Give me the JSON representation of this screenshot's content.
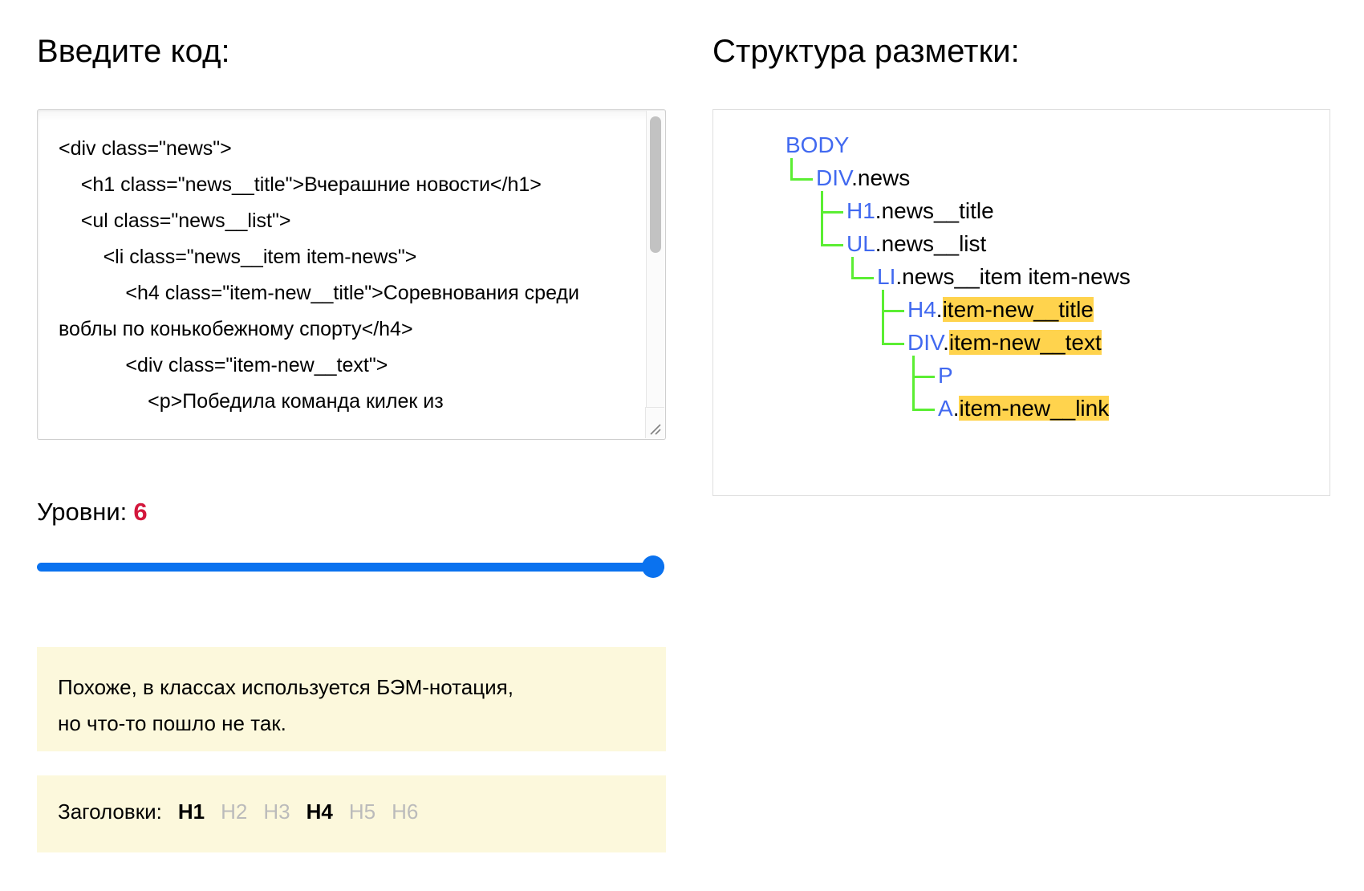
{
  "left": {
    "title": "Введите код:",
    "code": "<div class=\"news\">\n    <h1 class=\"news__title\">Вчерашние новости</h1>\n    <ul class=\"news__list\">\n        <li class=\"news__item item-news\">\n            <h4 class=\"item-new__title\">Соревнования среди воблы по конькобежному спорту</h4>\n            <div class=\"item-new__text\">\n                <p>Победила команда килек из",
    "levels_label": "Уровни:",
    "levels_value": "6",
    "slider": {
      "value": 6,
      "min": 1,
      "max": 6,
      "track_color": "#0a72ef",
      "thumb_color": "#0a72ef"
    },
    "note_bem": {
      "line1": "Похоже, в классах используется БЭМ-нотация,",
      "line2": "но что-то пошло не так.",
      "background": "#fcf8dc"
    },
    "headings": {
      "label": "Заголовки:",
      "tags": [
        {
          "name": "H1",
          "active": true
        },
        {
          "name": "H2",
          "active": false
        },
        {
          "name": "H3",
          "active": false
        },
        {
          "name": "H4",
          "active": true
        },
        {
          "name": "H5",
          "active": false
        },
        {
          "name": "H6",
          "active": false
        }
      ],
      "background": "#fcf8dc",
      "active_color": "#000000",
      "inactive_color": "#bbbbbb"
    }
  },
  "right": {
    "title": "Структура разметки:",
    "tree": {
      "tag_color": "#4169f0",
      "line_color": "#5bee33",
      "highlight_color": "#ffd34d",
      "nodes": [
        {
          "tag": "BODY",
          "cls": "",
          "highlight": false,
          "depth": 0
        },
        {
          "tag": "DIV",
          "cls": ".news",
          "highlight": false,
          "depth": 1
        },
        {
          "tag": "H1",
          "cls": ".news__title",
          "highlight": false,
          "depth": 2
        },
        {
          "tag": "UL",
          "cls": ".news__list",
          "highlight": false,
          "depth": 2
        },
        {
          "tag": "LI",
          "cls": ".news__item item-news",
          "highlight": false,
          "depth": 3
        },
        {
          "tag": "H4",
          "cls": "item-new__title",
          "highlight": true,
          "depth": 4,
          "dot": "."
        },
        {
          "tag": "DIV",
          "cls": "item-new__text",
          "highlight": true,
          "depth": 4,
          "dot": "."
        },
        {
          "tag": "P",
          "cls": "",
          "highlight": false,
          "depth": 5
        },
        {
          "tag": "A",
          "cls": "item-new__link",
          "highlight": true,
          "depth": 5,
          "dot": "."
        }
      ]
    }
  }
}
